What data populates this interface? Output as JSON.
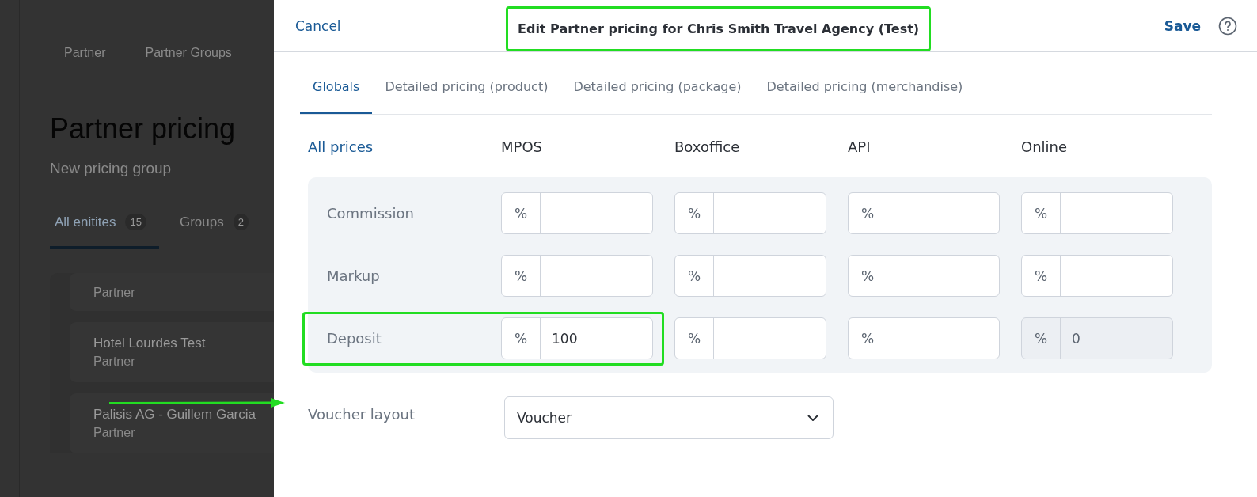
{
  "background_page": {
    "nav": [
      {
        "label": "Partner"
      },
      {
        "label": "Partner Groups"
      }
    ],
    "title": "Partner pricing",
    "subtitle": "New pricing group",
    "tabs": [
      {
        "label": "All enitites",
        "count": "15",
        "selected": true
      },
      {
        "label": "Groups",
        "count": "2",
        "selected": false
      }
    ],
    "cards": [
      {
        "subtitle": "Partner"
      },
      {
        "name": "Hotel Lourdes Test",
        "subtitle": "Partner"
      },
      {
        "name": "Palisis AG - Guillem Garcia",
        "subtitle": "Partner"
      }
    ]
  },
  "dialog": {
    "cancel": "Cancel",
    "title": "Edit Partner pricing for Chris Smith Travel Agency (Test)",
    "title_highlighted": true,
    "save": "Save",
    "tabs": [
      {
        "label": "Globals",
        "selected": true
      },
      {
        "label": "Detailed pricing (product)",
        "selected": false
      },
      {
        "label": "Detailed pricing (package)",
        "selected": false
      },
      {
        "label": "Detailed pricing (merchandise)",
        "selected": false
      }
    ],
    "columns": [
      "All prices",
      "MPOS",
      "Boxoffice",
      "API",
      "Online"
    ],
    "rows": [
      {
        "label": "Commission",
        "highlighted": false,
        "fields": [
          {
            "unit": "%",
            "disabled": false
          },
          {
            "unit": "%",
            "disabled": false
          },
          {
            "unit": "%",
            "disabled": false
          },
          {
            "unit": "%",
            "disabled": false
          }
        ]
      },
      {
        "label": "Markup",
        "highlighted": false,
        "fields": [
          {
            "unit": "%",
            "disabled": false
          },
          {
            "unit": "%",
            "disabled": false
          },
          {
            "unit": "%",
            "disabled": false
          },
          {
            "unit": "%",
            "disabled": false
          }
        ]
      },
      {
        "label": "Deposit",
        "highlighted": true,
        "fields": [
          {
            "unit": "%",
            "value": "100",
            "disabled": false
          },
          {
            "unit": "%",
            "disabled": false
          },
          {
            "unit": "%",
            "disabled": false
          },
          {
            "unit": "%",
            "value": "0",
            "disabled": true
          }
        ]
      }
    ],
    "voucher_layout": {
      "label": "Voucher layout",
      "value": "Voucher",
      "pointed": true
    }
  }
}
